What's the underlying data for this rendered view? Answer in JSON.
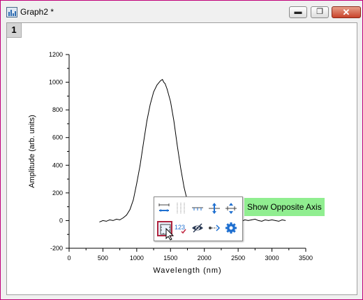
{
  "window": {
    "title": "Graph2 *",
    "accent_color": "#c0007a",
    "controls": [
      "minimize-icon",
      "restore-icon",
      "close-icon"
    ]
  },
  "layer_tab": "1",
  "chart_data": {
    "type": "line",
    "xlabel": "Wavelength (nm)",
    "ylabel": "Amplitude (arb. units)",
    "xlim": [
      0,
      3500
    ],
    "ylim": [
      -200,
      1200
    ],
    "xticks": [
      0,
      500,
      1000,
      1500,
      2000,
      2500,
      3000,
      3500
    ],
    "yticks": [
      -200,
      0,
      200,
      400,
      600,
      800,
      1000,
      1200
    ],
    "grid": false,
    "series": [
      {
        "color": "#000000",
        "x": [
          450,
          500,
          550,
          600,
          650,
          700,
          750,
          800,
          850,
          900,
          950,
          1000,
          1050,
          1100,
          1150,
          1200,
          1250,
          1300,
          1350,
          1380,
          1400,
          1420,
          1450,
          1500,
          1550,
          1600,
          1650,
          1700,
          1750,
          1800,
          1850,
          1900,
          1950,
          2000,
          2050,
          2100,
          2150,
          2200,
          2250,
          2300,
          2350,
          2400,
          2450,
          2500,
          2550,
          2600,
          2650,
          2700,
          2750,
          2800,
          2850,
          2900,
          2950,
          3000,
          3050,
          3100,
          3150,
          3200
        ],
        "y": [
          -10,
          0,
          -5,
          5,
          0,
          10,
          5,
          20,
          40,
          80,
          150,
          270,
          400,
          560,
          720,
          840,
          930,
          980,
          1010,
          1020,
          1000,
          990,
          950,
          860,
          720,
          540,
          380,
          240,
          140,
          70,
          30,
          10,
          5,
          -5,
          0,
          5,
          -5,
          10,
          0,
          5,
          -5,
          5,
          0,
          10,
          -5,
          5,
          0,
          5,
          10,
          0,
          -5,
          5,
          0,
          5,
          0,
          -5,
          5,
          0
        ]
      }
    ]
  },
  "mini_toolbar": {
    "buttons": [
      {
        "name": "axis-scale-icon"
      },
      {
        "name": "grid-lines-icon"
      },
      {
        "name": "tick-direction-icon"
      },
      {
        "name": "axis-rescale-vertical-icon"
      },
      {
        "name": "axis-rescale-cross-icon"
      },
      {
        "name": "show-opposite-axis-icon",
        "selected": true
      },
      {
        "name": "tick-label-numbering-icon"
      },
      {
        "name": "hide-axis-eye-icon"
      },
      {
        "name": "axis-connect-icon"
      },
      {
        "name": "settings-gear-icon"
      }
    ]
  },
  "tooltip": "Show Opposite Axis"
}
